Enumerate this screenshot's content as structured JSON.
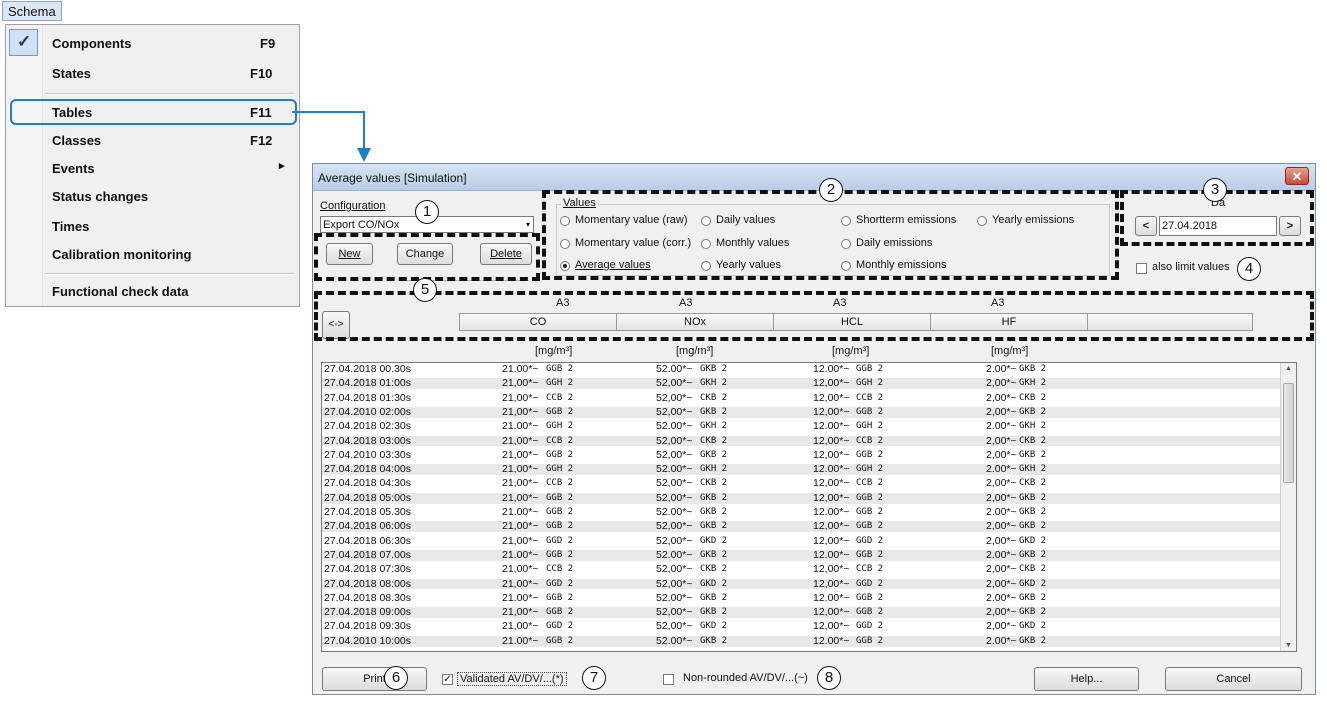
{
  "menu": {
    "title": "Schema",
    "items": [
      {
        "label": "Components",
        "key": "F9",
        "checked": true
      },
      {
        "label": "States",
        "key": "F10"
      },
      {
        "label": "Tables",
        "key": "F11",
        "highlighted": true
      },
      {
        "label": "Classes",
        "key": "F12"
      },
      {
        "label": "Events",
        "key": "",
        "submenu": true
      },
      {
        "label": "Status changes",
        "key": ""
      },
      {
        "label": "Times",
        "key": ""
      },
      {
        "label": "Calibration monitoring",
        "key": ""
      },
      {
        "label": "Functional check data",
        "key": ""
      }
    ],
    "check_glyph": "✓",
    "submenu_glyph": "▸"
  },
  "dialog": {
    "title": "Average values [Simulation]",
    "close_glyph": "✕",
    "configuration": {
      "label": "Configuration",
      "value": "Export CO/NOx",
      "new_label": "New",
      "change_label": "Change",
      "delete_label": "Delete"
    },
    "values": {
      "label": "Values",
      "options": [
        {
          "label": "Momentary value (raw)",
          "selected": false
        },
        {
          "label": "Daily values",
          "selected": false
        },
        {
          "label": "Shortterm emissions",
          "selected": false
        },
        {
          "label": "Yearly emissions",
          "selected": false
        },
        {
          "label": "Momentary value (corr.)",
          "selected": false
        },
        {
          "label": "Monthly values",
          "selected": false
        },
        {
          "label": "Daily emissions",
          "selected": false
        },
        {
          "label": "Average values",
          "selected": true
        },
        {
          "label": "Yearly values",
          "selected": false
        },
        {
          "label": "Monthly emissions",
          "selected": false
        }
      ]
    },
    "date": {
      "label": "Da",
      "value": "27.04.2018",
      "prev_glyph": "<",
      "next_glyph": ">"
    },
    "also_limit_values": {
      "label": "also limit values",
      "checked": false
    },
    "scroll_left_glyph": "<->",
    "columns": [
      {
        "group": "A3",
        "name": "CO",
        "unit": "[mg/m³]"
      },
      {
        "group": "A3",
        "name": "NOx",
        "unit": "[mg/m³]"
      },
      {
        "group": "A3",
        "name": "HCL",
        "unit": "[mg/m³]"
      },
      {
        "group": "A3",
        "name": "HF",
        "unit": "[mg/m³]"
      }
    ],
    "rows": [
      {
        "time": "27.04.2018 00.30s",
        "co": "21.00*~",
        "co_s": "GGB 2",
        "nox": "52.00*~",
        "nox_s": "GKB 2",
        "hcl": "12.00*~",
        "hcl_s": "GGB 2",
        "hf": "2.00*~",
        "hf_s": "GKB 2"
      },
      {
        "time": "27.04.2018 01:00s",
        "co": "21,00*~",
        "co_s": "GGH 2",
        "nox": "52,00*~",
        "nox_s": "GKH 2",
        "hcl": "12,00*~",
        "hcl_s": "GGH 2",
        "hf": "2,00*~",
        "hf_s": "GKH 2"
      },
      {
        "time": "27.04.2018 01:30s",
        "co": "21,00*~",
        "co_s": "CCB 2",
        "nox": "52,00*~",
        "nox_s": "CKB 2",
        "hcl": "12,00*~",
        "hcl_s": "CCB 2",
        "hf": "2,00*~",
        "hf_s": "CKB 2"
      },
      {
        "time": "27.04.2010 02:00s",
        "co": "21,00*~",
        "co_s": "GGB 2",
        "nox": "52,00*~",
        "nox_s": "GKB 2",
        "hcl": "12,00*~",
        "hcl_s": "GGB 2",
        "hf": "2,00*~",
        "hf_s": "GKB 2"
      },
      {
        "time": "27.04.2018 02:30s",
        "co": "21.00*~",
        "co_s": "GGH 2",
        "nox": "52.00*~",
        "nox_s": "GKH 2",
        "hcl": "12.00*~",
        "hcl_s": "GGH 2",
        "hf": "2.00*~",
        "hf_s": "GKH 2"
      },
      {
        "time": "27.04.2018 03:00s",
        "co": "21,00*~",
        "co_s": "CCB 2",
        "nox": "52,00*~",
        "nox_s": "CKB 2",
        "hcl": "12,00*~",
        "hcl_s": "CCB 2",
        "hf": "2,00*~",
        "hf_s": "CKB 2"
      },
      {
        "time": "27.04.2010 03:30s",
        "co": "21,00*~",
        "co_s": "GGB 2",
        "nox": "52,00*~",
        "nox_s": "GKB 2",
        "hcl": "12,00*~",
        "hcl_s": "GGB 2",
        "hf": "2,00*~",
        "hf_s": "GKB 2"
      },
      {
        "time": "27.04.2018 04:00s",
        "co": "21,00*~",
        "co_s": "GGH 2",
        "nox": "52.00*~",
        "nox_s": "GKH 2",
        "hcl": "12.00*~",
        "hcl_s": "GGH 2",
        "hf": "2.00*~",
        "hf_s": "GKH 2"
      },
      {
        "time": "27.04.2018 04:30s",
        "co": "21,00*~",
        "co_s": "CCB 2",
        "nox": "52,00*~",
        "nox_s": "CKB 2",
        "hcl": "12,00*~",
        "hcl_s": "CCB 2",
        "hf": "2,00*~",
        "hf_s": "CKB 2"
      },
      {
        "time": "27.04.2018 05:00s",
        "co": "21,00*~",
        "co_s": "GGB 2",
        "nox": "52,00*~",
        "nox_s": "GKB 2",
        "hcl": "12,00*~",
        "hcl_s": "GGB 2",
        "hf": "2,00*~",
        "hf_s": "GKB 2"
      },
      {
        "time": "27.04.2018 05.30s",
        "co": "21.00*~",
        "co_s": "GGB 2",
        "nox": "52.00*~",
        "nox_s": "GKB 2",
        "hcl": "12.00*~",
        "hcl_s": "GGB 2",
        "hf": "2.00*~",
        "hf_s": "GKB 2"
      },
      {
        "time": "27.04.2018 06:00s",
        "co": "21,00*~",
        "co_s": "GGB 2",
        "nox": "52,00*~",
        "nox_s": "GKB 2",
        "hcl": "12,00*~",
        "hcl_s": "GGB 2",
        "hf": "2,00*~",
        "hf_s": "GKB 2"
      },
      {
        "time": "27.04.2018 06:30s",
        "co": "21,00*~",
        "co_s": "GGD 2",
        "nox": "52,00*~",
        "nox_s": "GKD 2",
        "hcl": "12,00*~",
        "hcl_s": "GGD 2",
        "hf": "2,00*~",
        "hf_s": "GKD 2"
      },
      {
        "time": "27.04.2018 07.00s",
        "co": "21.00*~",
        "co_s": "GGB 2",
        "nox": "52.00*~",
        "nox_s": "GKB 2",
        "hcl": "12.00*~",
        "hcl_s": "GGB 2",
        "hf": "2.00*~",
        "hf_s": "GKB 2"
      },
      {
        "time": "27.04.2018 07:30s",
        "co": "21,00*~",
        "co_s": "CCB 2",
        "nox": "52,00*~",
        "nox_s": "CKB 2",
        "hcl": "12,00*~",
        "hcl_s": "CCB 2",
        "hf": "2,00*~",
        "hf_s": "CKB 2"
      },
      {
        "time": "27.04.2018 08:00s",
        "co": "21,00*~",
        "co_s": "GGD 2",
        "nox": "52,00*~",
        "nox_s": "GKD 2",
        "hcl": "12,00*~",
        "hcl_s": "GGD 2",
        "hf": "2,00*~",
        "hf_s": "GKD 2"
      },
      {
        "time": "27.04.2018 08.30s",
        "co": "21.00*~",
        "co_s": "GGB 2",
        "nox": "52.00*~",
        "nox_s": "GKB 2",
        "hcl": "12.00*~",
        "hcl_s": "GGB 2",
        "hf": "2.00*~",
        "hf_s": "GKB 2"
      },
      {
        "time": "27.04.2018 09:00s",
        "co": "21,00*~",
        "co_s": "GGB 2",
        "nox": "52,00*~",
        "nox_s": "GKB 2",
        "hcl": "12,00*~",
        "hcl_s": "GGB 2",
        "hf": "2,00*~",
        "hf_s": "GKB 2"
      },
      {
        "time": "27.04.2018 09:30s",
        "co": "21,00*~",
        "co_s": "GGD 2",
        "nox": "52,00*~",
        "nox_s": "GKD 2",
        "hcl": "12,00*~",
        "hcl_s": "GGD 2",
        "hf": "2,00*~",
        "hf_s": "GKD 2"
      },
      {
        "time": "27.04.2010 10:00s",
        "co": "21.00*~",
        "co_s": "GGB 2",
        "nox": "52.00*~",
        "nox_s": "GKB 2",
        "hcl": "12.00*~",
        "hcl_s": "GGB 2",
        "hf": "2.00*~",
        "hf_s": "GKB 2"
      }
    ],
    "footer": {
      "print_label": "Print",
      "validated_label": "Validated AV/DV/...(*)",
      "validated_checked": true,
      "nonrounded_label": "Non-rounded AV/DV/...(~)",
      "nonrounded_checked": false,
      "help_label": "Help...",
      "cancel_label": "Cancel"
    }
  },
  "callouts": [
    "1",
    "2",
    "3",
    "4",
    "5",
    "6",
    "7",
    "8"
  ],
  "colors": {
    "accent": "#1f7ec4",
    "dashes": "#111111"
  }
}
